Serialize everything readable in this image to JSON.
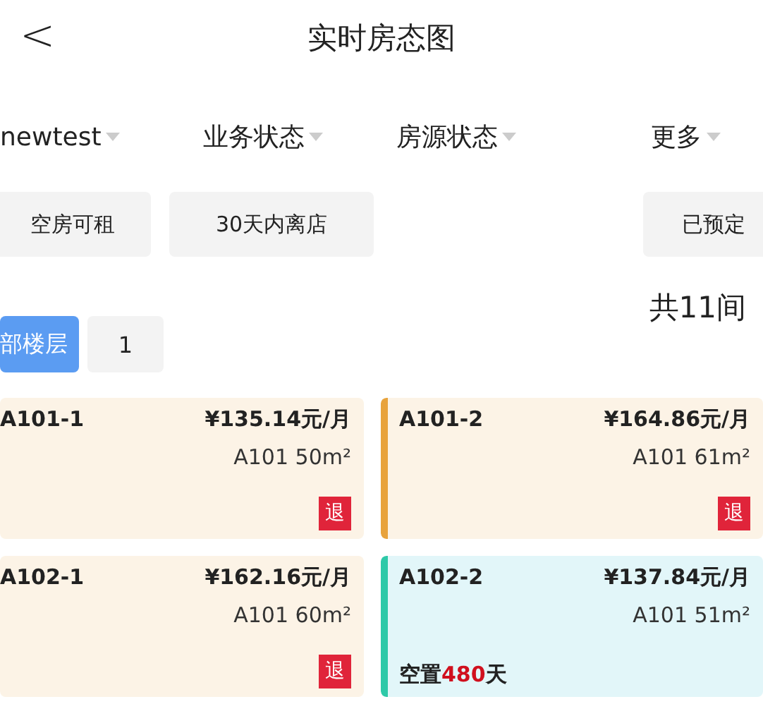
{
  "header": {
    "back": "<",
    "title": "实时房态图"
  },
  "filters": [
    {
      "label": "newtest"
    },
    {
      "label": "业务状态"
    },
    {
      "label": "房源状态"
    },
    {
      "label": "更多"
    }
  ],
  "chips": [
    {
      "label": "空房可租"
    },
    {
      "label": "30天内离店"
    },
    {
      "label": "已预定"
    }
  ],
  "total": "共11间",
  "floors": [
    {
      "label": "部楼层",
      "selected": true
    },
    {
      "label": "1",
      "selected": false
    }
  ],
  "rooms": [
    {
      "kind": "checkout",
      "name": "A101-1",
      "price": "¥135.14元/月",
      "area": "A101 50m²",
      "tag": "退"
    },
    {
      "kind": "checkout",
      "name": "A101-2",
      "price": "¥164.86元/月",
      "area": "A101 61m²",
      "tag": "退",
      "color": "#e8a33c"
    },
    {
      "kind": "checkout",
      "name": "A102-1",
      "price": "¥162.16元/月",
      "area": "A101 60m²",
      "tag": "退"
    },
    {
      "kind": "vacant",
      "name": "A102-2",
      "price": "¥137.84元/月",
      "area": "A101 51m²",
      "vacancy": {
        "prefix": "空置",
        "days": "480",
        "suffix": "天"
      },
      "color": "#2ec9a8"
    }
  ]
}
